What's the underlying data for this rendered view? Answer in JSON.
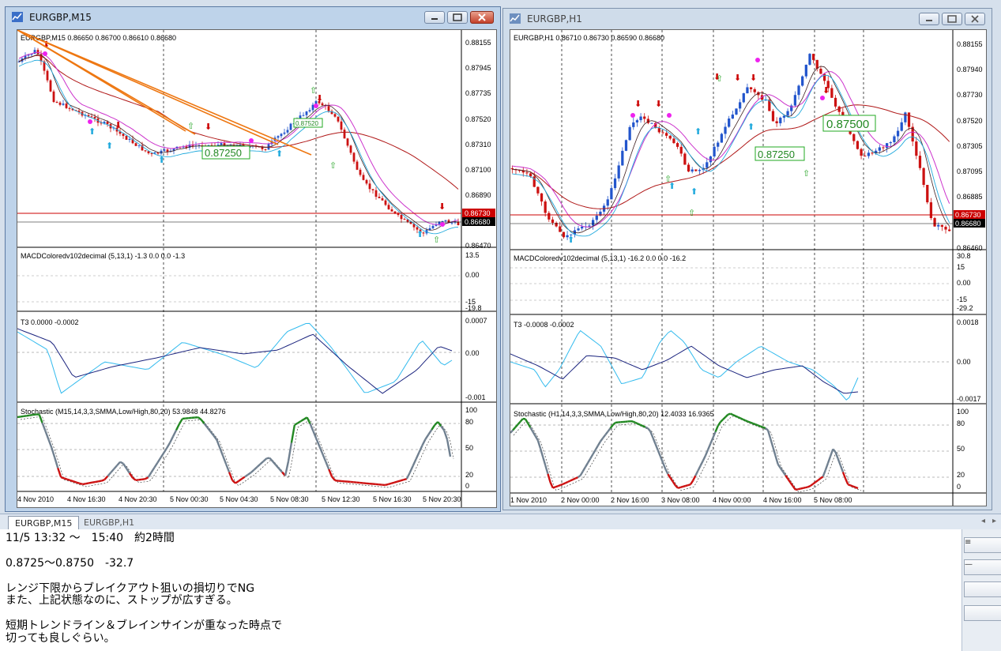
{
  "windows": [
    {
      "title": "EURGBP,M15",
      "price_header": "EURGBP,M15  0.86650 0.86700 0.86610 0.86680",
      "price_levels": [
        "0.88155",
        "0.87945",
        "0.87735",
        "0.87520",
        "0.87310",
        "0.87100",
        "0.86890",
        "0.86680",
        "0.86470"
      ],
      "red_line_label": "0.86730",
      "current_price": "0.86680",
      "annotation_box": "0.87250",
      "annotation_small": "0.87520",
      "macd_label": "MACDColoredv102decimal (5,13,1) -1.3 0.0 0.0 -1.3",
      "macd_levels": [
        "13.5",
        "0.00",
        "-15",
        "-19.8"
      ],
      "t3_label": "T3 0.0000 -0.0002",
      "t3_levels": [
        "0.0007",
        "0.00",
        "-0.001"
      ],
      "stoch_label": "Stochastic (M15,14,3,3,SMMA,Low/High,80,20) 53.9848 44.8276",
      "stoch_levels": [
        "100",
        "80",
        "50",
        "20",
        "0"
      ],
      "time_labels": [
        "4 Nov 2010",
        "4 Nov 16:30",
        "4 Nov 20:30",
        "5 Nov 00:30",
        "5 Nov 04:30",
        "5 Nov 08:30",
        "5 Nov 12:30",
        "5 Nov 16:30",
        "5 Nov 20:30"
      ]
    },
    {
      "title": "EURGBP,H1",
      "price_header": "EURGBP,H1  0.86710 0.86730 0.86590 0.86680",
      "price_levels": [
        "0.88155",
        "0.87940",
        "0.87730",
        "0.87520",
        "0.87305",
        "0.87095",
        "0.86885",
        "0.86675",
        "0.86460"
      ],
      "red_line_label": "0.86730",
      "current_price": "0.86680",
      "annotation_box": "0.87250",
      "annotation_large": "0.87500",
      "macd_label": "MACDColoredv102decimal (5,13,1) -16.2 0.0 0.0 -16.2",
      "macd_levels": [
        "30.8",
        "15",
        "0.00",
        "-15",
        "-29.2"
      ],
      "t3_label": "T3 -0.0008 -0.0002",
      "t3_levels": [
        "0.0018",
        "0.00",
        "-0.0017"
      ],
      "stoch_label": "Stochastic (H1,14,3,3,SMMA,Low/High,80,20) 12.4033 16.9365",
      "stoch_levels": [
        "100",
        "80",
        "50",
        "20",
        "0"
      ],
      "time_labels": [
        "1 Nov 2010",
        "2 Nov 00:00",
        "2 Nov 16:00",
        "3 Nov 08:00",
        "4 Nov 00:00",
        "4 Nov 16:00",
        "5 Nov 08:00"
      ]
    }
  ],
  "tabs": [
    "EURGBP,M15",
    "EURGBP,H1"
  ],
  "notes": {
    "line1": "11/5 13:32 ～　15:40　約2時間",
    "line2": "0.8725～0.8750　-32.7",
    "line3": "レンジ下限からブレイクアウト狙いの損切りでNG",
    "line4": "また、上記状態なのに、ストップが広すぎる。",
    "line5": "短期トレンドライン＆ブレインサインが重なった時点で",
    "line6": "切っても良しぐらい。"
  },
  "side_buttons": [
    "≡",
    "—",
    "",
    ""
  ],
  "colors": {
    "bull_candle": "#2255cc",
    "bear_candle": "#cc1111",
    "ma_red": "#b01818",
    "ma_magenta": "#cc33cc",
    "ma_dark": "#402020",
    "signal_cyan": "#22aadd",
    "trendline": "#ee7711",
    "stoch_green": "#228822",
    "stoch_red": "#cc1111",
    "stoch_gray": "#708090",
    "t3_cyan": "#33bbee",
    "t3_navy": "#1a237e",
    "price_tag_red": "#cc0000"
  }
}
